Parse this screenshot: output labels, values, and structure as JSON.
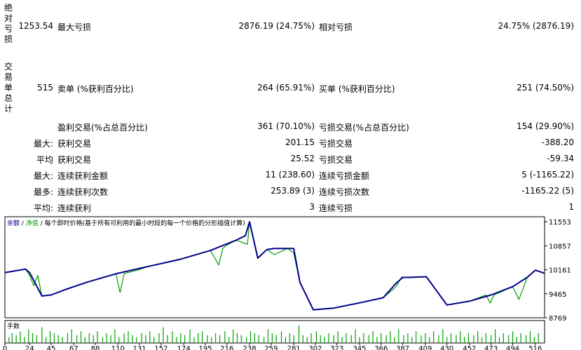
{
  "stats": {
    "abs_label": "绝对亏损",
    "abs_value": "1253.54",
    "max_dd_label": "最大亏损",
    "max_dd_value": "2876.19 (24.75%)",
    "rel_dd_label": "相对亏损",
    "rel_dd_value": "24.75% (2876.19)",
    "trades_label": "交易单总计",
    "trades_value": "515",
    "short_label": "卖单 (%获利百分比)",
    "short_value": "264 (65.91%)",
    "long_label": "买单 (%获利百分比)",
    "long_value": "251 (74.50%)",
    "profit_trades_label": "盈利交易(%占总百分比)",
    "profit_trades_value": "361 (70.10%)",
    "loss_trades_label": "亏损交易(%占总百分比)",
    "loss_trades_value": "154 (29.90%)",
    "largest_prefix": "最大:",
    "largest_profit_label": "获利交易",
    "largest_profit_value": "201.15",
    "largest_loss_label": "亏损交易",
    "largest_loss_value": "-388.20",
    "average_prefix": "平均",
    "average_profit_label": "获利交易",
    "average_profit_value": "25.52",
    "average_loss_label": "亏损交易",
    "average_loss_value": "-59.34",
    "max_consec_prefix": "最大:",
    "max_consec_wins_label": "连续获利金额",
    "max_consec_wins_value": "11 (238.60)",
    "max_consec_losses_label": "连续亏损金额",
    "max_consec_losses_value": "5 (-1165.22)",
    "maximal_prefix": "最多:",
    "maximal_wins_label": "连续获利次数",
    "maximal_wins_value": "253.89 (3)",
    "maximal_losses_label": "连续亏损次数",
    "maximal_losses_value": "-1165.22 (5)",
    "avg_consec_prefix": "平均:",
    "avg_consec_wins_label": "连续获利",
    "avg_consec_wins_value": "3",
    "avg_consec_losses_label": "连续亏损",
    "avg_consec_losses_value": "1"
  },
  "chart_data": [
    {
      "type": "line",
      "legend_text": "余额 / 净值 / 每个即时价格(基于所有可利用的最小时段的每一个价格的分形插值计算)",
      "legend_parts": [
        "余额",
        "/",
        "净值",
        "/",
        "每个即时价格(基于所有可利用的最小时段的每一个价格的分形插值计算)"
      ],
      "yticks": [
        11553,
        10857,
        10161,
        9465,
        8769
      ],
      "ylim": [
        8769,
        11700
      ],
      "xlim": [
        0,
        525
      ],
      "xticks": [
        0,
        24,
        45,
        67,
        88,
        110,
        131,
        152,
        174,
        195,
        216,
        238,
        259,
        281,
        302,
        323,
        345,
        366,
        387,
        409,
        430,
        452,
        473,
        494,
        516
      ],
      "series": [
        {
          "name": "余额",
          "color": "#00008b",
          "x": [
            0,
            20,
            24,
            36,
            45,
            60,
            80,
            110,
            140,
            170,
            200,
            225,
            234,
            238,
            246,
            255,
            262,
            275,
            281,
            287,
            300,
            320,
            345,
            368,
            380,
            387,
            393,
            410,
            430,
            452,
            473,
            494,
            508,
            516,
            525
          ],
          "y": [
            10080,
            10180,
            10080,
            9400,
            9430,
            9600,
            9800,
            10060,
            10260,
            10460,
            10720,
            11020,
            11150,
            11553,
            10500,
            10750,
            10780,
            10780,
            10780,
            9800,
            9000,
            9050,
            9200,
            9350,
            9750,
            9940,
            9940,
            9960,
            9140,
            9250,
            9430,
            9670,
            9940,
            10150,
            10060
          ]
        },
        {
          "name": "净值",
          "color": "#00a000",
          "x": [
            0,
            20,
            24,
            28,
            32,
            36,
            45,
            80,
            108,
            112,
            116,
            130,
            140,
            170,
            200,
            208,
            212,
            216,
            225,
            236,
            238,
            246,
            255,
            262,
            275,
            281,
            287,
            300,
            320,
            345,
            368,
            380,
            386,
            390,
            410,
            430,
            452,
            468,
            472,
            476,
            494,
            500,
            504,
            508,
            516,
            525
          ],
          "y": [
            10080,
            10180,
            10000,
            9700,
            10000,
            9400,
            9430,
            9800,
            10050,
            9500,
            10050,
            10160,
            10260,
            10460,
            10720,
            10300,
            10780,
            10880,
            11020,
            10900,
            11553,
            10500,
            10750,
            10600,
            10780,
            10650,
            9800,
            9000,
            9050,
            9200,
            9350,
            9650,
            9950,
            9940,
            9960,
            9140,
            9250,
            9430,
            9200,
            9430,
            9670,
            9300,
            9600,
            9940,
            10150,
            10060
          ]
        }
      ]
    },
    {
      "type": "bar",
      "title": "手数",
      "color": "#00a000",
      "xlim": [
        0,
        525
      ],
      "x": [
        4,
        7,
        11,
        15,
        19,
        23,
        27,
        31,
        36,
        40,
        44,
        48,
        52,
        56,
        61,
        65,
        70,
        74,
        78,
        82,
        86,
        90,
        95,
        99,
        103,
        107,
        111,
        116,
        120,
        124,
        128,
        133,
        137,
        141,
        145,
        150,
        154,
        158,
        163,
        167,
        171,
        175,
        180,
        184,
        188,
        192,
        197,
        201,
        205,
        209,
        214,
        218,
        222,
        226,
        230,
        235,
        239,
        243,
        247,
        252,
        256,
        260,
        264,
        269,
        273,
        277,
        281,
        286,
        290,
        294,
        298,
        303,
        307,
        311,
        315,
        320,
        324,
        328,
        332,
        337,
        341,
        345,
        349,
        354,
        358,
        362,
        366,
        371,
        375,
        379,
        383,
        388,
        392,
        396,
        400,
        405,
        409,
        413,
        417,
        422,
        426,
        430,
        434,
        439,
        443,
        447,
        451,
        456,
        460,
        464,
        468,
        473,
        477,
        481,
        485,
        490,
        494,
        498,
        502,
        507,
        511,
        515,
        519
      ],
      "values": [
        0.3,
        0.5,
        0.4,
        0.6,
        0.3,
        0.7,
        0.5,
        0.4,
        0.8,
        0.3,
        0.6,
        0.5,
        0.4,
        0.3,
        0.5,
        0.7,
        0.4,
        0.6,
        0.3,
        0.5,
        0.4,
        0.6,
        0.3,
        0.5,
        0.4,
        0.7,
        0.3,
        0.5,
        0.6,
        0.4,
        0.3,
        0.5,
        0.4,
        0.6,
        0.3,
        0.5,
        0.8,
        0.4,
        0.6,
        0.3,
        0.5,
        0.4,
        0.7,
        0.3,
        0.5,
        0.6,
        0.4,
        0.3,
        0.5,
        0.4,
        0.6,
        0.3,
        0.7,
        0.5,
        0.4,
        0.3,
        0.6,
        0.5,
        0.4,
        0.3,
        0.7,
        0.5,
        0.4,
        0.6,
        0.3,
        0.5,
        0.4,
        0.9,
        0.4,
        0.3,
        0.5,
        0.6,
        0.4,
        0.3,
        0.5,
        0.4,
        0.6,
        0.3,
        0.5,
        0.4,
        0.7,
        0.3,
        0.5,
        0.4,
        0.6,
        0.3,
        0.5,
        0.4,
        0.6,
        0.3,
        0.7,
        0.4,
        0.5,
        0.3,
        0.6,
        0.4,
        0.5,
        0.3,
        0.6,
        0.4,
        0.7,
        0.3,
        0.5,
        0.4,
        0.6,
        0.3,
        0.5,
        0.4,
        0.6,
        0.3,
        0.5,
        0.4,
        0.7,
        0.3,
        0.5,
        0.4,
        0.6,
        0.3,
        0.5,
        0.4,
        0.6,
        0.3,
        0.5
      ]
    }
  ]
}
